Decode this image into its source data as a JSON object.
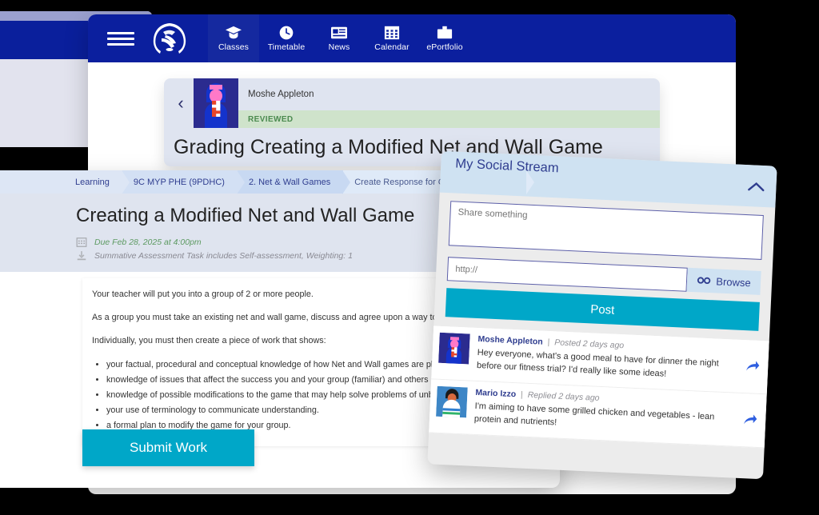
{
  "topnav": {
    "menu_icon": "hamburger-icon",
    "crest_icon": "school-crest-icon",
    "items": [
      {
        "label": "Classes",
        "icon": "graduation-cap-icon",
        "active": true
      },
      {
        "label": "Timetable",
        "icon": "clock-icon",
        "active": false
      },
      {
        "label": "News",
        "icon": "news-icon",
        "active": false
      },
      {
        "label": "Calendar",
        "icon": "calendar-icon",
        "active": false
      },
      {
        "label": "ePortfolio",
        "icon": "briefcase-icon",
        "active": false
      }
    ]
  },
  "grading": {
    "back_icon": "chevron-left-icon",
    "avatar_icon": "student-avatar-icon",
    "student_name": "Moshe Appleton",
    "status": "REVIEWED",
    "title": "Grading Creating a Modified Net and Wall Game"
  },
  "assignment": {
    "breadcrumb": [
      "Learning",
      "9C MYP PHE (9PDHC)",
      "2. Net & Wall Games",
      "Create Response for Creating a Modified "
    ],
    "title": "Creating a Modified Net and Wall Game",
    "due": "Due Feb 28, 2025 at 4:00pm",
    "due_icon": "calendar-icon",
    "summary": "Summative Assessment Task includes Self-assessment, Weighting: 1",
    "summary_icon": "download-icon",
    "paragraphs": [
      "Your teacher will put you into a group of 2 or more people.",
      "As a group you must take an existing net and wall game, discuss and agree upon a way to modify",
      "Individually, you must then create a piece of work that shows:"
    ],
    "bullets": [
      "your factual, procedural and conceptual knowledge of how Net and Wall games are played an",
      "knowledge of issues that affect the success you and your group (familiar) and others (unfamil",
      "knowledge of possible modifications to the game that may help solve problems of unbalance",
      "your use of terminology to communicate understanding.",
      "a formal plan to modify the game for your group."
    ],
    "submit_label": "Submit Work"
  },
  "social": {
    "title": "My Social Stream",
    "collapse_icon": "chevron-up-icon",
    "share_placeholder": "Share something",
    "share_value": "",
    "url_placeholder": "http://",
    "url_value": "",
    "browse_label": "Browse",
    "browse_icon": "link-icon",
    "post_label": "Post",
    "posts": [
      {
        "author": "Moshe Appleton",
        "separator": "|",
        "time": "Posted 2 days ago",
        "avatar_icon": "student-avatar-icon",
        "share_icon": "share-arrow-icon",
        "text": "Hey everyone, what's a good meal to have for dinner the night before our fitness trial? I'd really like some ideas!"
      },
      {
        "author": "Mario Izzo",
        "separator": "|",
        "time": "Replied 2 days ago",
        "avatar_icon": "student-avatar-icon-2",
        "share_icon": "share-arrow-icon",
        "text": "I'm aiming to have some grilled chicken and vegetables - lean protein and nutrients!"
      }
    ]
  },
  "colors": {
    "nav_blue": "#0b1f9e",
    "accent_cyan": "#00a7c8",
    "status_green": "#4b8a4f",
    "breadcrumb_blue": "#2f3d8f"
  }
}
